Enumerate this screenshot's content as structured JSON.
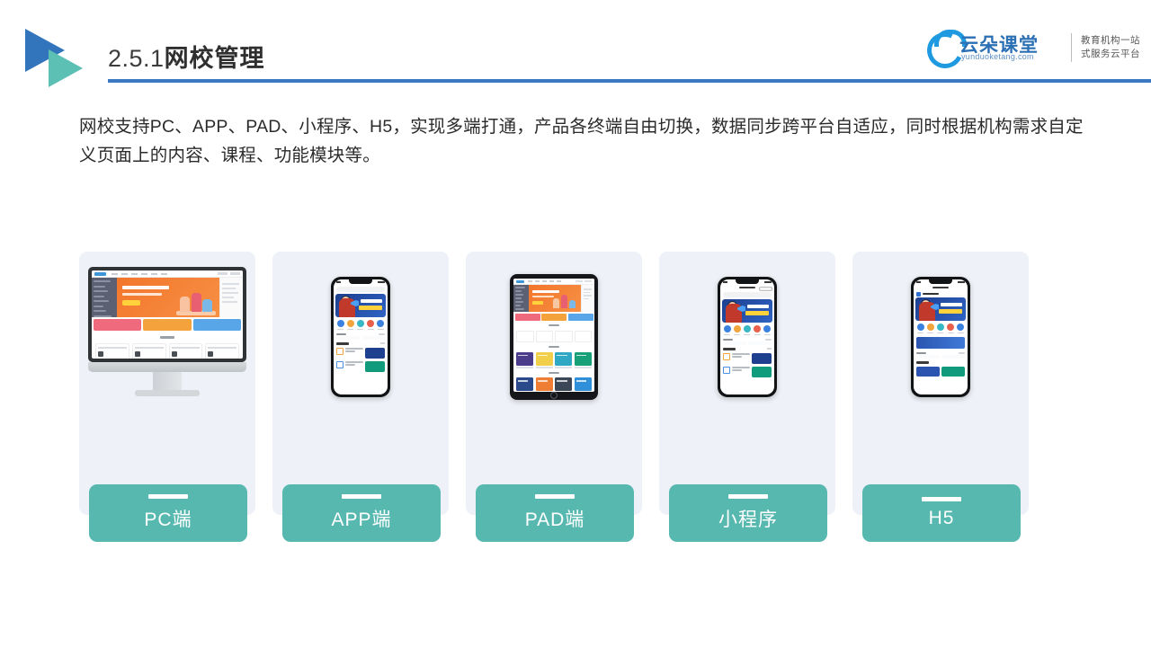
{
  "header": {
    "title_number": "2.5.1",
    "title_text": "网校管理",
    "logo_icon": "play-triangle-logo",
    "brand": {
      "name": "云朵课堂",
      "url": "yunduoketang.com",
      "tagline_line1": "教育机构一站",
      "tagline_line2": "式服务云平台",
      "cloud_icon": "cloud-icon"
    },
    "rule_color": "#3b79c2"
  },
  "body": {
    "paragraph": "网校支持PC、APP、PAD、小程序、H5，实现多端打通，产品各终端自由切换，数据同步跨平台自适应，同时根据机构需求自定义页面上的内容、课程、功能模块等。"
  },
  "cards": [
    {
      "label": "PC端",
      "device": "desktop-monitor",
      "icon": "desktop-icon"
    },
    {
      "label": "APP端",
      "device": "smartphone",
      "icon": "mobile-icon"
    },
    {
      "label": "PAD端",
      "device": "tablet",
      "icon": "tablet-icon"
    },
    {
      "label": "小程序",
      "device": "smartphone-miniprogram",
      "icon": "miniprogram-icon"
    },
    {
      "label": "H5",
      "device": "smartphone-h5",
      "icon": "h5-icon"
    }
  ],
  "colors": {
    "accent_blue": "#3b79c2",
    "logo_blue": "#3375bd",
    "logo_teal": "#5cc0b4",
    "label_teal": "#57b8b0",
    "card_bg": "#eef1f7",
    "text_dark": "#2b2b2b",
    "banner_orange": "#f2762c",
    "banner_blue": "#2f63c4"
  }
}
